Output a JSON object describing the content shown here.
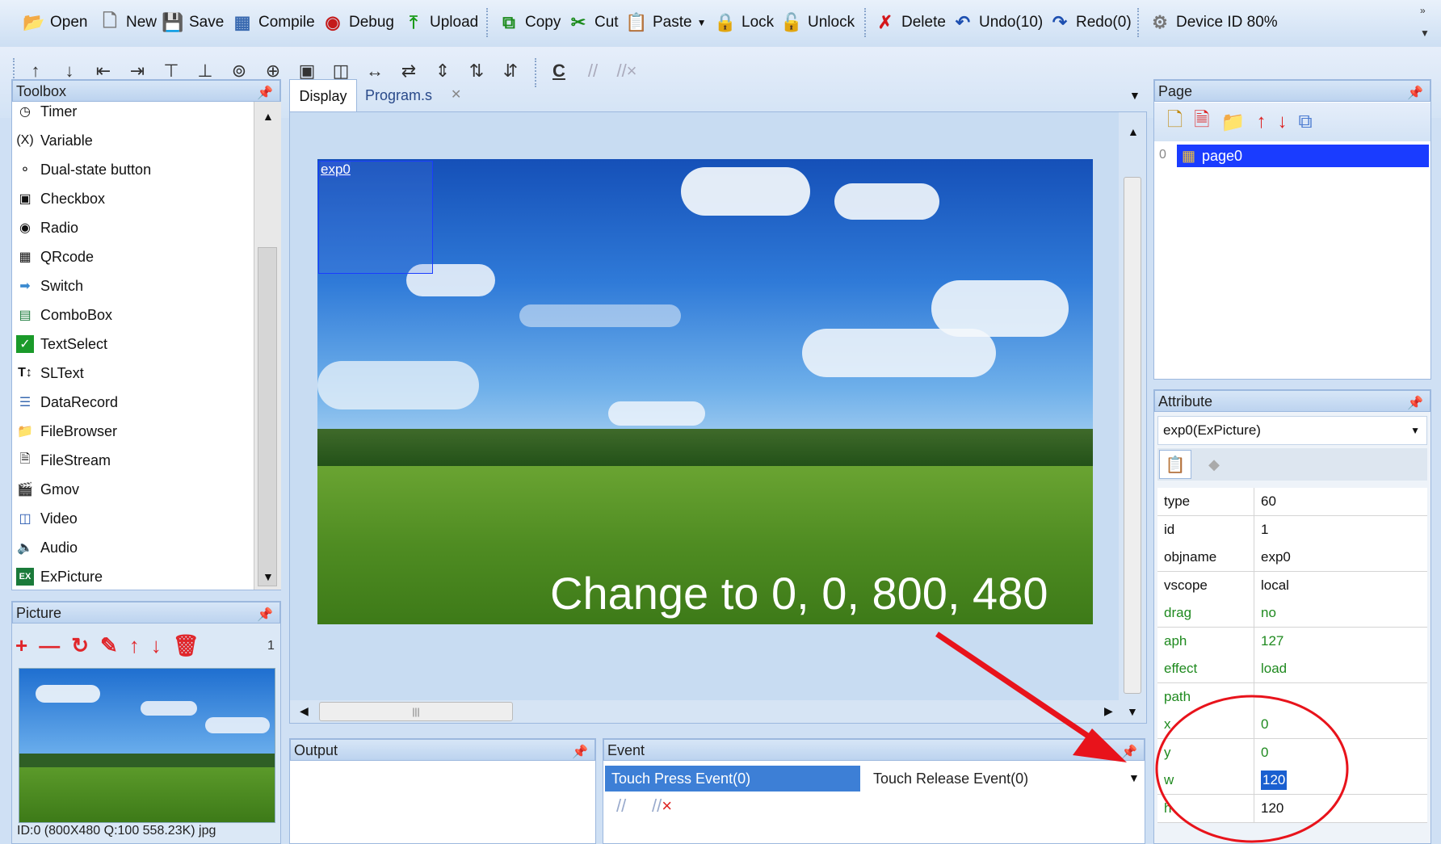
{
  "toolbar": {
    "open": "Open",
    "new": "New",
    "save": "Save",
    "compile": "Compile",
    "debug": "Debug",
    "upload": "Upload",
    "copy": "Copy",
    "cut": "Cut",
    "paste": "Paste",
    "lock": "Lock",
    "unlock": "Unlock",
    "delete": "Delete",
    "undo": "Undo(10)",
    "redo": "Redo(0)",
    "device": "Device ID 80%"
  },
  "toolbox": {
    "title": "Toolbox",
    "items": [
      "Timer",
      "Variable",
      "Dual-state button",
      "Checkbox",
      "Radio",
      "QRcode",
      "Switch",
      "ComboBox",
      "TextSelect",
      "SLText",
      "DataRecord",
      "FileBrowser",
      "FileStream",
      "Gmov",
      "Video",
      "Audio",
      "ExPicture"
    ]
  },
  "picture": {
    "title": "Picture",
    "count": "1",
    "caption": "ID:0  (800X480 Q:100 558.23K) jpg"
  },
  "tabs": {
    "display": "Display",
    "program": "Program.s"
  },
  "canvas": {
    "object_label": "exp0",
    "overlay_text": "Change to 0, 0, 800, 480"
  },
  "output": {
    "title": "Output"
  },
  "event": {
    "title": "Event",
    "tab_press": "Touch Press Event(0)",
    "tab_release": "Touch Release Event(0)"
  },
  "page": {
    "title": "Page",
    "index": "0",
    "name": "page0"
  },
  "attribute": {
    "title": "Attribute",
    "selected": "exp0(ExPicture)",
    "rows": [
      {
        "k": "type",
        "v": "60"
      },
      {
        "k": "id",
        "v": "1"
      },
      {
        "k": "objname",
        "v": "exp0"
      },
      {
        "k": "vscope",
        "v": "local"
      },
      {
        "k": "drag",
        "v": "no"
      },
      {
        "k": "aph",
        "v": "127"
      },
      {
        "k": "effect",
        "v": "load"
      },
      {
        "k": "path",
        "v": ""
      },
      {
        "k": "x",
        "v": "0"
      },
      {
        "k": "y",
        "v": "0"
      },
      {
        "k": "w",
        "v": "120"
      },
      {
        "k": "h",
        "v": "120"
      }
    ]
  },
  "colors": {
    "accent": "#1a3cff",
    "annotation": "#e8131b",
    "panel": "#bcd3ef"
  }
}
